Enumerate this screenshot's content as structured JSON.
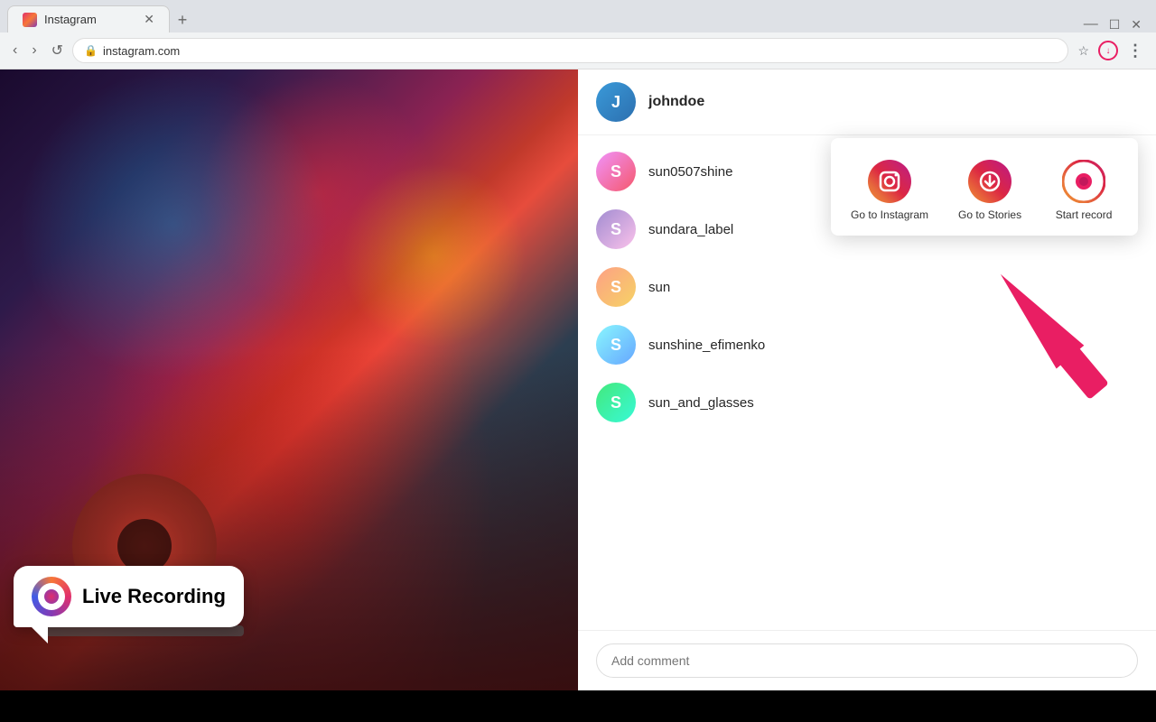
{
  "browser": {
    "tab_title": "Instagram",
    "url": "instagram.com",
    "new_tab_label": "+"
  },
  "popup": {
    "items": [
      {
        "id": "go-to-instagram",
        "label": "Go to Instagram",
        "icon": "instagram-icon"
      },
      {
        "id": "go-to-stories",
        "label": "Go to Stories",
        "icon": "stories-icon"
      },
      {
        "id": "start-record",
        "label": "Start record",
        "icon": "record-icon"
      }
    ]
  },
  "user_header": {
    "username": "johndoe"
  },
  "followers": [
    {
      "username": "sun0507shine",
      "avatar_class": "avatar-sun0507"
    },
    {
      "username": "sundara_label",
      "avatar_class": "avatar-sundara"
    },
    {
      "username": "sun",
      "avatar_class": "avatar-sun"
    },
    {
      "username": "sunshine_efimenko",
      "avatar_class": "avatar-sunshine"
    },
    {
      "username": "sun_and_glasses",
      "avatar_class": "avatar-sunglasses"
    }
  ],
  "comment_placeholder": "Add comment",
  "live_recording_label": "Live Recording",
  "nav": {
    "back": "‹",
    "forward": "›",
    "refresh": "↺"
  }
}
